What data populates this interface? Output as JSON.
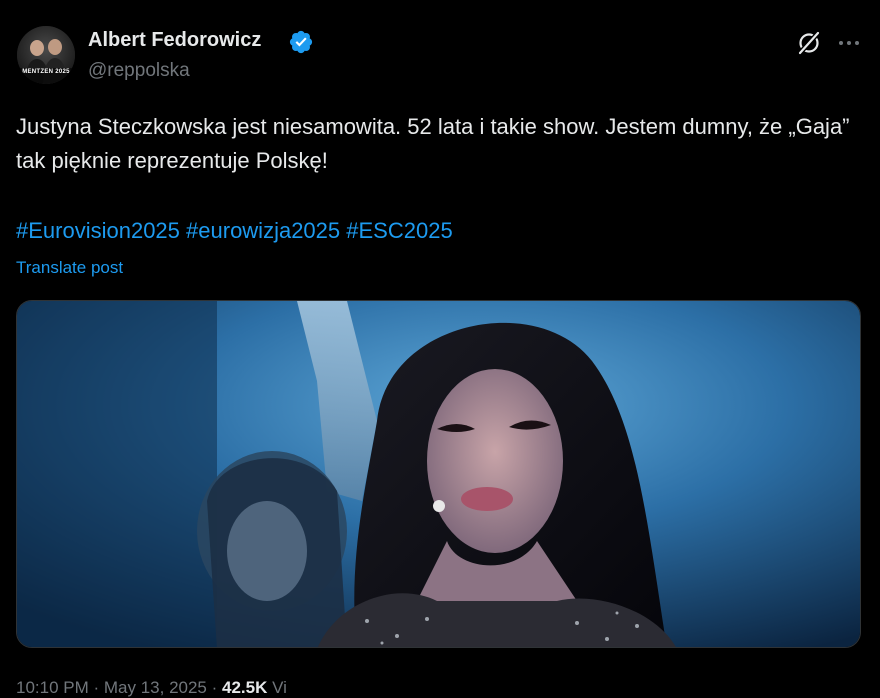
{
  "author": {
    "name": "Albert Fedorowicz",
    "handle": "@reppolska",
    "avatar_text": "MENTZEN 2025",
    "verified": true
  },
  "actions": {
    "grok_icon": "grok-icon",
    "more_icon": "more-dots-icon"
  },
  "post": {
    "text": "Justyna Steczkowska jest niesamowita. 52 lata i takie show. Jestem dumny, że „Gaja” tak pięknie reprezentuje Polskę!",
    "hashtags": [
      "#Eurovision2025",
      "#eurowizja2025",
      "#ESC2025"
    ],
    "translate_label": "Translate post"
  },
  "meta": {
    "time": "10:10 PM · May 13, 2025",
    "separator": " · ",
    "views_count": "42.5K",
    "views_label": " Vi"
  },
  "colors": {
    "background": "#000000",
    "text": "#e7e9ea",
    "secondary": "#71767b",
    "link": "#1d9bf0",
    "verified": "#1d9bf0",
    "border": "#2f3336"
  }
}
